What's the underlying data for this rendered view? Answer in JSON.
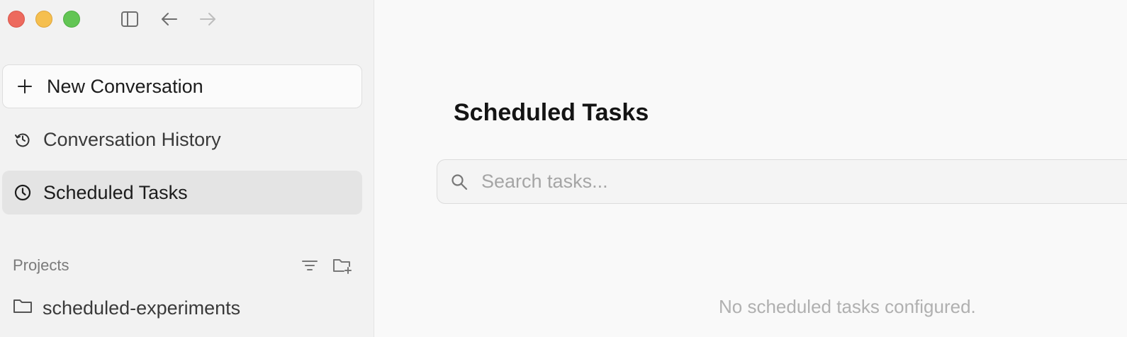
{
  "window": {
    "traffic_lights": [
      "close",
      "minimize",
      "maximize"
    ]
  },
  "toolbar": {
    "icons": [
      "sidebar-toggle-icon",
      "back-arrow-icon",
      "forward-arrow-icon"
    ]
  },
  "sidebar": {
    "new_conversation": "New Conversation",
    "history": "Conversation History",
    "scheduled": "Scheduled Tasks",
    "projects_title": "Projects",
    "projects": [
      {
        "name": "scheduled-experiments"
      }
    ]
  },
  "main": {
    "title": "Scheduled Tasks",
    "search_placeholder": "Search tasks...",
    "empty_message": "No scheduled tasks configured."
  },
  "colors": {
    "close": "#ed6a5e",
    "minimize": "#f5bf4f",
    "maximize": "#62c554",
    "selected_bg": "#e4e4e4"
  }
}
